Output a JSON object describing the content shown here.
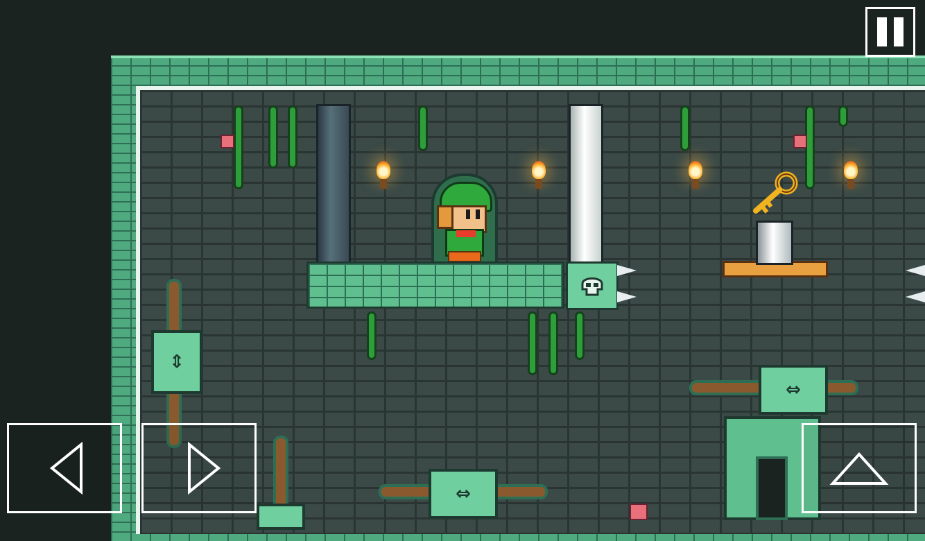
{
  "hud": {
    "pause_button_icon": "pause-icon"
  },
  "controls": {
    "left_icon": "arrow-left-icon",
    "right_icon": "arrow-right-icon",
    "jump_icon": "arrow-up-icon"
  },
  "scene": {
    "player": "green-hat-hero",
    "key": "golden-key",
    "skull_block": "skull-icon"
  },
  "colors": {
    "wall": "#4faa80",
    "background": "#3b4a47",
    "outer": "#1a2320",
    "vine": "#2e9e3a",
    "flame": "#ffb433",
    "key": "#f2b320"
  }
}
